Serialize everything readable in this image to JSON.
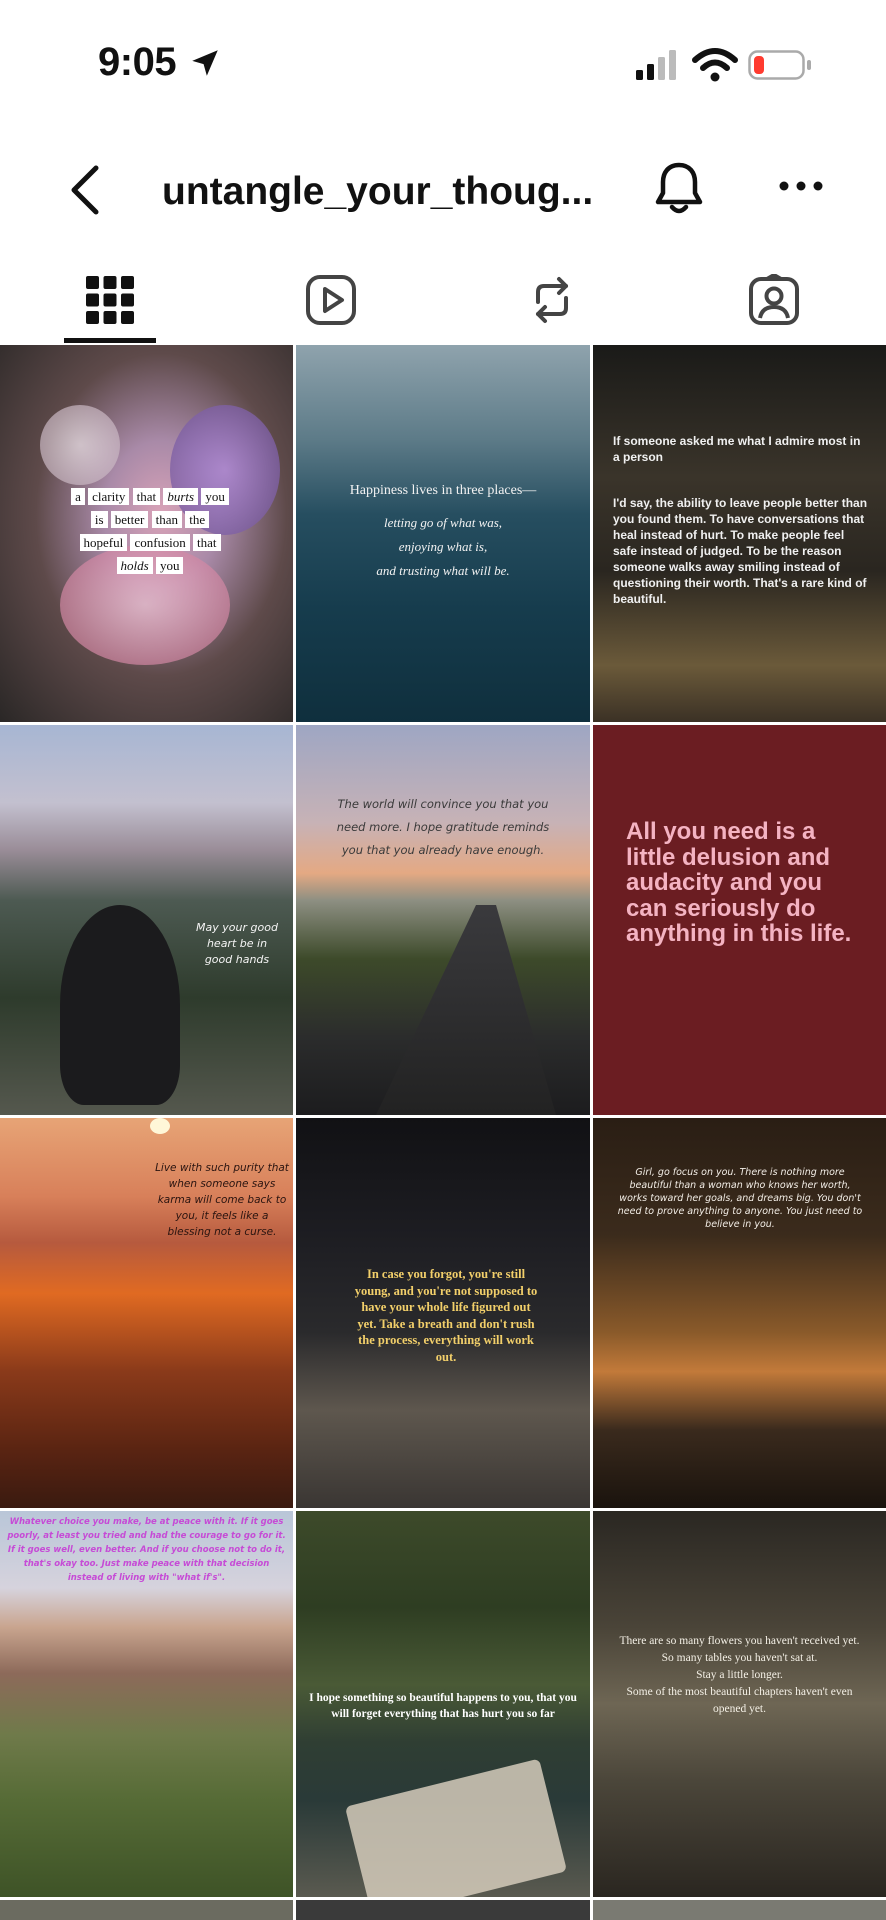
{
  "status": {
    "time": "9:05",
    "icons": [
      "location-arrow-icon",
      "cellular-signal-icon",
      "wifi-icon",
      "battery-low-icon"
    ],
    "battery_color": "#ff3b30"
  },
  "header": {
    "title": "untangle_your_thoug...",
    "icons": [
      "back-chevron-icon",
      "bell-icon",
      "more-dots-icon"
    ]
  },
  "tabs": [
    {
      "icon": "grid-icon",
      "selected": true
    },
    {
      "icon": "reels-icon",
      "selected": false
    },
    {
      "icon": "reposts-icon",
      "selected": false
    },
    {
      "icon": "tagged-icon",
      "selected": false
    }
  ],
  "posts": {
    "p1": {
      "words": [
        "a",
        "clarity",
        "that",
        "burts",
        "you",
        "is",
        "better",
        "than",
        "the",
        "hopeful",
        "confusion",
        "that",
        "holds",
        "you"
      ]
    },
    "p2": {
      "line1": "Happiness lives in three places—",
      "line2": "letting go of what was,",
      "line3": "enjoying what is,",
      "line4": "and trusting what will be."
    },
    "p3": {
      "heading": "If someone asked me what I admire most in a person",
      "body": "I'd say, the ability to leave people better than you found them. To have conversations that heal instead of hurt. To make people feel safe instead of judged. To be the reason someone walks away smiling instead of questioning their worth. That's a rare kind of beautiful."
    },
    "p4": {
      "text": "May your good heart be in good hands"
    },
    "p5": {
      "text": "The world will convince you that you need more. I hope gratitude reminds you that you already have enough."
    },
    "p6": {
      "text": "All you need is a little delusion and audacity and you can seriously do anything in this life."
    },
    "p7": {
      "text": "Live with such purity that when someone says karma will come back to you, it feels like a blessing not a curse."
    },
    "p8": {
      "text": "In case you forgot, you're still young, and you're not supposed to have your whole life figured out yet. Take a breath and don't rush the process, everything will work out."
    },
    "p9": {
      "text": "Girl, go focus on you. There is nothing more beautiful than a woman who knows her worth, works toward her goals, and dreams big. You don't need to prove anything to anyone. You just need to believe in you."
    },
    "p10": {
      "text": "Whatever choice you make, be at peace with it. If it goes poorly, at least you tried and had the courage to go for it. If it goes well, even better. And if you choose not to do it, that's okay too. Just make peace with that decision instead of living with \"what if's\"."
    },
    "p11": {
      "text": "I hope something so beautiful happens to you, that you will forget everything that has hurt you so far"
    },
    "p12": {
      "lines": [
        "There are so many flowers you haven't received yet.",
        "So many tables you haven't sat at.",
        "Stay a little longer.",
        "Some of the most beautiful chapters haven't even opened yet."
      ]
    }
  },
  "colors": {
    "accent_text": "#111111",
    "p6_background": "#6b1d22",
    "p6_text": "#f4b3c2",
    "p10_text": "#c64bd6"
  }
}
